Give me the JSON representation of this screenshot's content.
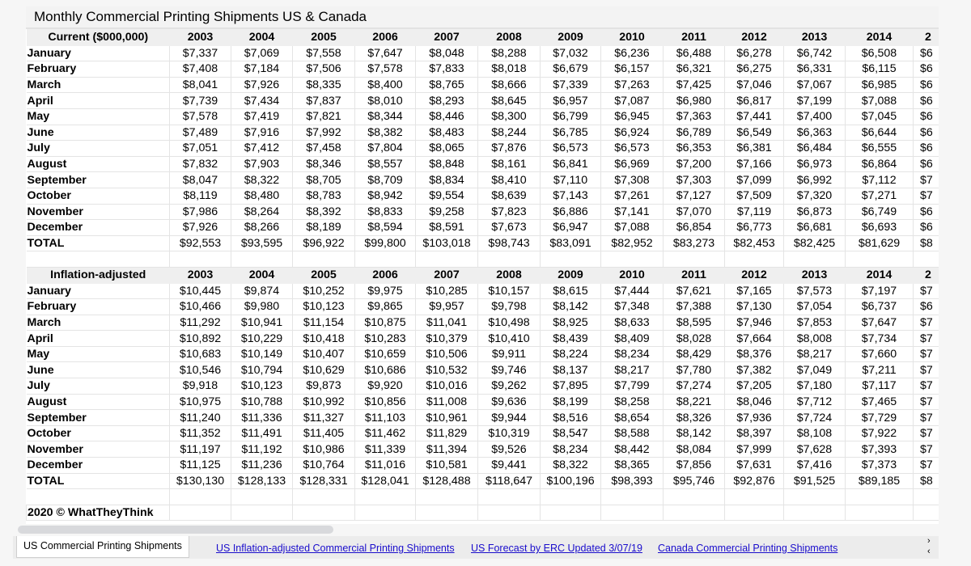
{
  "title": "Monthly Commercial Printing Shipments US & Canada",
  "years": [
    "2003",
    "2004",
    "2005",
    "2006",
    "2007",
    "2008",
    "2009",
    "2010",
    "2011",
    "2012",
    "2013",
    "2014"
  ],
  "clipped_year_header": "2",
  "current": {
    "header": "Current ($000,000)",
    "rows": [
      {
        "label": "January",
        "values": [
          "$7,337",
          "$7,069",
          "$7,558",
          "$7,647",
          "$8,048",
          "$8,288",
          "$7,032",
          "$6,236",
          "$6,488",
          "$6,278",
          "$6,742",
          "$6,508"
        ],
        "clipped": "$6"
      },
      {
        "label": "February",
        "values": [
          "$7,408",
          "$7,184",
          "$7,506",
          "$7,578",
          "$7,833",
          "$8,018",
          "$6,679",
          "$6,157",
          "$6,321",
          "$6,275",
          "$6,331",
          "$6,115"
        ],
        "clipped": "$6"
      },
      {
        "label": "March",
        "values": [
          "$8,041",
          "$7,926",
          "$8,335",
          "$8,400",
          "$8,765",
          "$8,666",
          "$7,339",
          "$7,263",
          "$7,425",
          "$7,046",
          "$7,067",
          "$6,985"
        ],
        "clipped": "$6"
      },
      {
        "label": "April",
        "values": [
          "$7,739",
          "$7,434",
          "$7,837",
          "$8,010",
          "$8,293",
          "$8,645",
          "$6,957",
          "$7,087",
          "$6,980",
          "$6,817",
          "$7,199",
          "$7,088"
        ],
        "clipped": "$6"
      },
      {
        "label": "May",
        "values": [
          "$7,578",
          "$7,419",
          "$7,821",
          "$8,344",
          "$8,446",
          "$8,300",
          "$6,799",
          "$6,945",
          "$7,363",
          "$7,441",
          "$7,400",
          "$7,045"
        ],
        "clipped": "$6"
      },
      {
        "label": "June",
        "values": [
          "$7,489",
          "$7,916",
          "$7,992",
          "$8,382",
          "$8,483",
          "$8,244",
          "$6,785",
          "$6,924",
          "$6,789",
          "$6,549",
          "$6,363",
          "$6,644"
        ],
        "clipped": "$6"
      },
      {
        "label": "July",
        "values": [
          "$7,051",
          "$7,412",
          "$7,458",
          "$7,804",
          "$8,065",
          "$7,876",
          "$6,573",
          "$6,573",
          "$6,353",
          "$6,381",
          "$6,484",
          "$6,555"
        ],
        "clipped": "$6"
      },
      {
        "label": "August",
        "values": [
          "$7,832",
          "$7,903",
          "$8,346",
          "$8,557",
          "$8,848",
          "$8,161",
          "$6,841",
          "$6,969",
          "$7,200",
          "$7,166",
          "$6,973",
          "$6,864"
        ],
        "clipped": "$6"
      },
      {
        "label": "September",
        "values": [
          "$8,047",
          "$8,322",
          "$8,705",
          "$8,709",
          "$8,834",
          "$8,410",
          "$7,110",
          "$7,308",
          "$7,303",
          "$7,099",
          "$6,992",
          "$7,112"
        ],
        "clipped": "$7"
      },
      {
        "label": "October",
        "values": [
          "$8,119",
          "$8,480",
          "$8,783",
          "$8,942",
          "$9,554",
          "$8,639",
          "$7,143",
          "$7,261",
          "$7,127",
          "$7,509",
          "$7,320",
          "$7,271"
        ],
        "clipped": "$7"
      },
      {
        "label": "November",
        "values": [
          "$7,986",
          "$8,264",
          "$8,392",
          "$8,833",
          "$9,258",
          "$7,823",
          "$6,886",
          "$7,141",
          "$7,070",
          "$7,119",
          "$6,873",
          "$6,749"
        ],
        "clipped": "$6"
      },
      {
        "label": "December",
        "values": [
          "$7,926",
          "$8,266",
          "$8,189",
          "$8,594",
          "$8,591",
          "$7,673",
          "$6,947",
          "$7,088",
          "$6,854",
          "$6,773",
          "$6,681",
          "$6,693"
        ],
        "clipped": "$6"
      },
      {
        "label": "TOTAL",
        "values": [
          "$92,553",
          "$93,595",
          "$96,922",
          "$99,800",
          "$103,018",
          "$98,743",
          "$83,091",
          "$82,952",
          "$83,273",
          "$82,453",
          "$82,425",
          "$81,629"
        ],
        "clipped": "$8"
      }
    ]
  },
  "inflation": {
    "header": "Inflation-adjusted",
    "rows": [
      {
        "label": "January",
        "values": [
          "$10,445",
          "$9,874",
          "$10,252",
          "$9,975",
          "$10,285",
          "$10,157",
          "$8,615",
          "$7,444",
          "$7,621",
          "$7,165",
          "$7,573",
          "$7,197"
        ],
        "clipped": "$7"
      },
      {
        "label": "February",
        "values": [
          "$10,466",
          "$9,980",
          "$10,123",
          "$9,865",
          "$9,957",
          "$9,798",
          "$8,142",
          "$7,348",
          "$7,388",
          "$7,130",
          "$7,054",
          "$6,737"
        ],
        "clipped": "$6"
      },
      {
        "label": "March",
        "values": [
          "$11,292",
          "$10,941",
          "$11,154",
          "$10,875",
          "$11,041",
          "$10,498",
          "$8,925",
          "$8,633",
          "$8,595",
          "$7,946",
          "$7,853",
          "$7,647"
        ],
        "clipped": "$7"
      },
      {
        "label": "April",
        "values": [
          "$10,892",
          "$10,229",
          "$10,418",
          "$10,283",
          "$10,379",
          "$10,410",
          "$8,439",
          "$8,409",
          "$8,028",
          "$7,664",
          "$8,008",
          "$7,734"
        ],
        "clipped": "$7"
      },
      {
        "label": "May",
        "values": [
          "$10,683",
          "$10,149",
          "$10,407",
          "$10,659",
          "$10,506",
          "$9,911",
          "$8,224",
          "$8,234",
          "$8,429",
          "$8,376",
          "$8,217",
          "$7,660"
        ],
        "clipped": "$7"
      },
      {
        "label": "June",
        "values": [
          "$10,546",
          "$10,794",
          "$10,629",
          "$10,686",
          "$10,532",
          "$9,746",
          "$8,137",
          "$8,217",
          "$7,780",
          "$7,382",
          "$7,049",
          "$7,211"
        ],
        "clipped": "$7"
      },
      {
        "label": "July",
        "values": [
          "$9,918",
          "$10,123",
          "$9,873",
          "$9,920",
          "$10,016",
          "$9,262",
          "$7,895",
          "$7,799",
          "$7,274",
          "$7,205",
          "$7,180",
          "$7,117"
        ],
        "clipped": "$7"
      },
      {
        "label": "August",
        "values": [
          "$10,975",
          "$10,788",
          "$10,992",
          "$10,856",
          "$11,008",
          "$9,636",
          "$8,199",
          "$8,258",
          "$8,221",
          "$8,046",
          "$7,712",
          "$7,465"
        ],
        "clipped": "$7"
      },
      {
        "label": "September",
        "values": [
          "$11,240",
          "$11,336",
          "$11,327",
          "$11,103",
          "$10,961",
          "$9,944",
          "$8,516",
          "$8,654",
          "$8,326",
          "$7,936",
          "$7,724",
          "$7,729"
        ],
        "clipped": "$7"
      },
      {
        "label": "October",
        "values": [
          "$11,352",
          "$11,491",
          "$11,405",
          "$11,462",
          "$11,829",
          "$10,319",
          "$8,547",
          "$8,588",
          "$8,142",
          "$8,397",
          "$8,108",
          "$7,922"
        ],
        "clipped": "$7"
      },
      {
        "label": "November",
        "values": [
          "$11,197",
          "$11,192",
          "$10,986",
          "$11,339",
          "$11,394",
          "$9,526",
          "$8,234",
          "$8,442",
          "$8,084",
          "$7,999",
          "$7,628",
          "$7,393"
        ],
        "clipped": "$7"
      },
      {
        "label": "December",
        "values": [
          "$11,125",
          "$11,236",
          "$10,764",
          "$11,016",
          "$10,581",
          "$9,441",
          "$8,322",
          "$8,365",
          "$7,856",
          "$7,631",
          "$7,416",
          "$7,373"
        ],
        "clipped": "$7"
      },
      {
        "label": "TOTAL",
        "values": [
          "$130,130",
          "$128,133",
          "$128,331",
          "$128,041",
          "$128,488",
          "$118,647",
          "$100,196",
          "$98,393",
          "$95,746",
          "$92,876",
          "$91,525",
          "$89,185"
        ],
        "clipped": "$8"
      }
    ]
  },
  "copyright": "2020 © WhatTheyThink",
  "tabs": [
    {
      "label": "US Commercial Printing Shipments",
      "active": true
    },
    {
      "label": "US Inflation-adjusted Commercial Printing Shipments",
      "active": false
    },
    {
      "label": "US Forecast by ERC Updated 3/07/19",
      "active": false
    },
    {
      "label": "Canada Commercial Printing Shipments",
      "active": false
    }
  ],
  "tab_scroll": {
    "right": "›",
    "left": "‹"
  },
  "colors": {
    "link": "#1a0dcc",
    "header_bg": "#efefef",
    "grid": "#e4e4e4"
  }
}
